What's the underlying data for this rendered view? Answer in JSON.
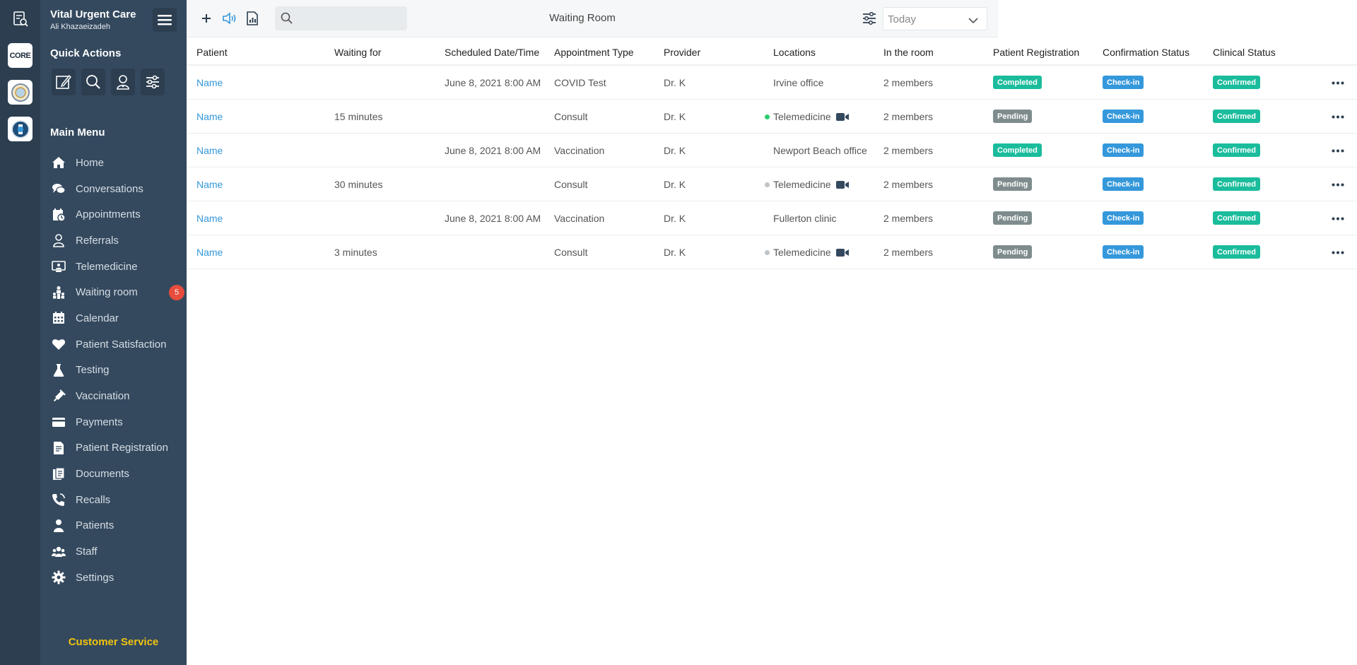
{
  "app": {
    "org_name": "Vital Urgent Care",
    "user_name": "Ali Khazaeizadeh",
    "rail_core_label": "CORE"
  },
  "sidebar": {
    "quick_actions_title": "Quick Actions",
    "main_menu_title": "Main Menu",
    "items": [
      {
        "label": "Home",
        "icon": "home-icon"
      },
      {
        "label": "Conversations",
        "icon": "chat-icon"
      },
      {
        "label": "Appointments",
        "icon": "calendar-clock-icon"
      },
      {
        "label": "Referrals",
        "icon": "user-icon"
      },
      {
        "label": "Telemedicine",
        "icon": "monitor-icon"
      },
      {
        "label": "Waiting room",
        "icon": "waiting-room-icon",
        "badge": "5"
      },
      {
        "label": "Calendar",
        "icon": "calendar-icon"
      },
      {
        "label": "Patient Satisfaction",
        "icon": "heart-icon"
      },
      {
        "label": "Testing",
        "icon": "flask-icon"
      },
      {
        "label": "Vaccination",
        "icon": "syringe-icon"
      },
      {
        "label": "Payments",
        "icon": "credit-card-icon"
      },
      {
        "label": "Patient Registration",
        "icon": "form-icon"
      },
      {
        "label": "Documents",
        "icon": "document-icon"
      },
      {
        "label": "Recalls",
        "icon": "phone-icon"
      },
      {
        "label": "Patients",
        "icon": "patient-icon"
      },
      {
        "label": "Staff",
        "icon": "staff-icon"
      },
      {
        "label": "Settings",
        "icon": "gear-icon"
      }
    ],
    "customer_service": "Customer Service"
  },
  "toolbar": {
    "title": "Waiting Room",
    "search_placeholder": "",
    "date_filter": "Today"
  },
  "table": {
    "columns": [
      "Patient",
      "Waiting for",
      "Scheduled Date/Time",
      "Appointment Type",
      "Provider",
      "Locations",
      "In the room",
      "Patient Registration",
      "Confirmation Status",
      "Clinical Status"
    ],
    "rows": [
      {
        "patient": "Name",
        "waiting": "",
        "scheduled": "June 8, 2021 8:00 AM",
        "type": "COVID Test",
        "provider": "Dr. K",
        "location": "Irvine office",
        "telemed": false,
        "dot": "",
        "in_room": "2 members",
        "registration": "Completed",
        "confirmation": "Check-in",
        "clinical": "Confirmed"
      },
      {
        "patient": "Name",
        "waiting": "15 minutes",
        "scheduled": "",
        "type": "Consult",
        "provider": "Dr. K",
        "location": "Telemedicine",
        "telemed": true,
        "dot": "#2ecc71",
        "in_room": "2 members",
        "registration": "Pending",
        "confirmation": "Check-in",
        "clinical": "Confirmed"
      },
      {
        "patient": "Name",
        "waiting": "",
        "scheduled": "June 8, 2021 8:00 AM",
        "type": "Vaccination",
        "provider": "Dr. K",
        "location": "Newport Beach office",
        "telemed": false,
        "dot": "",
        "in_room": "2 members",
        "registration": "Completed",
        "confirmation": "Check-in",
        "clinical": "Confirmed"
      },
      {
        "patient": "Name",
        "waiting": "30 minutes",
        "scheduled": "",
        "type": "Consult",
        "provider": "Dr. K",
        "location": "Telemedicine",
        "telemed": true,
        "dot": "#bdc3c7",
        "in_room": "2 members",
        "registration": "Pending",
        "confirmation": "Check-in",
        "clinical": "Confirmed"
      },
      {
        "patient": "Name",
        "waiting": "",
        "scheduled": "June 8, 2021 8:00 AM",
        "type": "Vaccination",
        "provider": "Dr. K",
        "location": "Fullerton clinic",
        "telemed": false,
        "dot": "",
        "in_room": "2 members",
        "registration": "Pending",
        "confirmation": "Check-in",
        "clinical": "Confirmed"
      },
      {
        "patient": "Name",
        "waiting": "3 minutes",
        "scheduled": "",
        "type": "Consult",
        "provider": "Dr. K",
        "location": "Telemedicine",
        "telemed": true,
        "dot": "#bdc3c7",
        "in_room": "2 members",
        "registration": "Pending",
        "confirmation": "Check-in",
        "clinical": "Confirmed"
      }
    ]
  },
  "colors": {
    "rail": "#2c3e50",
    "sidebar": "#34495e",
    "accent_link": "#3498db",
    "completed": "#1abc9c",
    "pending": "#7f8c8d",
    "badge": "#e74c3c",
    "customer_service": "#f1c40f"
  }
}
